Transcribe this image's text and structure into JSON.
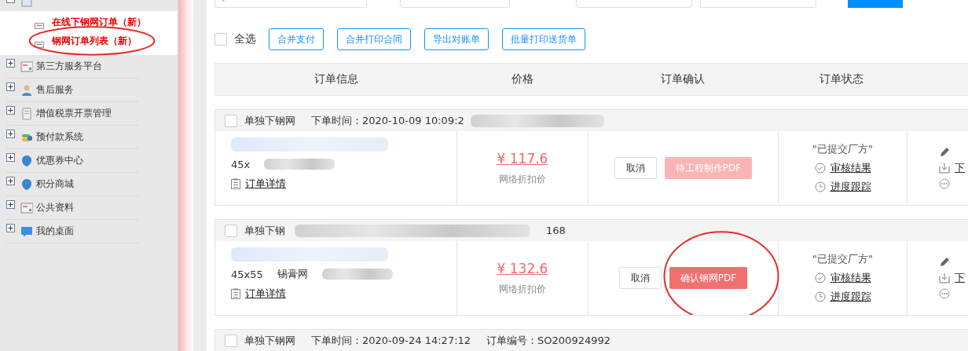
{
  "sidebar": {
    "groups": [
      {
        "expanded": true,
        "kind": "doc",
        "children": [
          {
            "label": "在线下钢网订单（新）",
            "highlight": false
          },
          {
            "label": "钢网订单列表（新）",
            "highlight": true
          }
        ]
      },
      {
        "label": "第三方服务平台",
        "expanded": false,
        "kind": "card"
      },
      {
        "label": "售后服务",
        "expanded": false,
        "kind": "person"
      },
      {
        "label": "增值税票开票管理",
        "expanded": false,
        "kind": "receipt"
      },
      {
        "label": "预付款系统",
        "expanded": false,
        "kind": "stack"
      },
      {
        "label": "优惠券中心",
        "expanded": false,
        "kind": "shield"
      },
      {
        "label": "积分商城",
        "expanded": false,
        "kind": "shield"
      },
      {
        "label": "公共资料",
        "expanded": false,
        "kind": "card"
      },
      {
        "label": "我的桌面",
        "expanded": false,
        "kind": "bubble"
      }
    ]
  },
  "toolbar": {
    "select_all": {
      "label": "全选",
      "checked": false
    },
    "buttons": [
      "合并支付",
      "合并打印合同",
      "导出对账单",
      "批量打印送货单"
    ]
  },
  "table": {
    "columns": [
      "订单信息",
      "价格",
      "订单确认",
      "订单状态"
    ],
    "orders": [
      {
        "checked": false,
        "redacted": true,
        "type": "单独下钢网",
        "time": "下单时间：2020-10-09 10:09:2",
        "spec": "45x",
        "detail_link": "订单详情",
        "price": "¥ 117.6",
        "price_note": "网络折扣价",
        "cancel": "取消",
        "confirm": {
          "label": "待工程制作PDF",
          "disabled": true,
          "highlight": false
        },
        "status": "\"已提交厂方\"",
        "links": [
          "审核结果",
          "进度跟踪"
        ],
        "download": "下"
      },
      {
        "checked": false,
        "redacted": true,
        "type": "单独下钢",
        "order_no": "168",
        "spec": "45x55",
        "material": "锡膏网",
        "detail_link": "订单详情",
        "price": "¥ 132.6",
        "price_note": "网络折扣价",
        "cancel": "取消",
        "confirm": {
          "label": "确认钢网PDF",
          "disabled": false,
          "highlight": true
        },
        "status": "\"已提交厂方\"",
        "links": [
          "审核结果",
          "进度跟踪"
        ],
        "download": "下"
      },
      {
        "checked": false,
        "redacted": false,
        "type": "单独下钢网",
        "time": "下单时间：2020-09-24 14:27:12",
        "order_no": "订单编号：SO200924992"
      }
    ]
  }
}
